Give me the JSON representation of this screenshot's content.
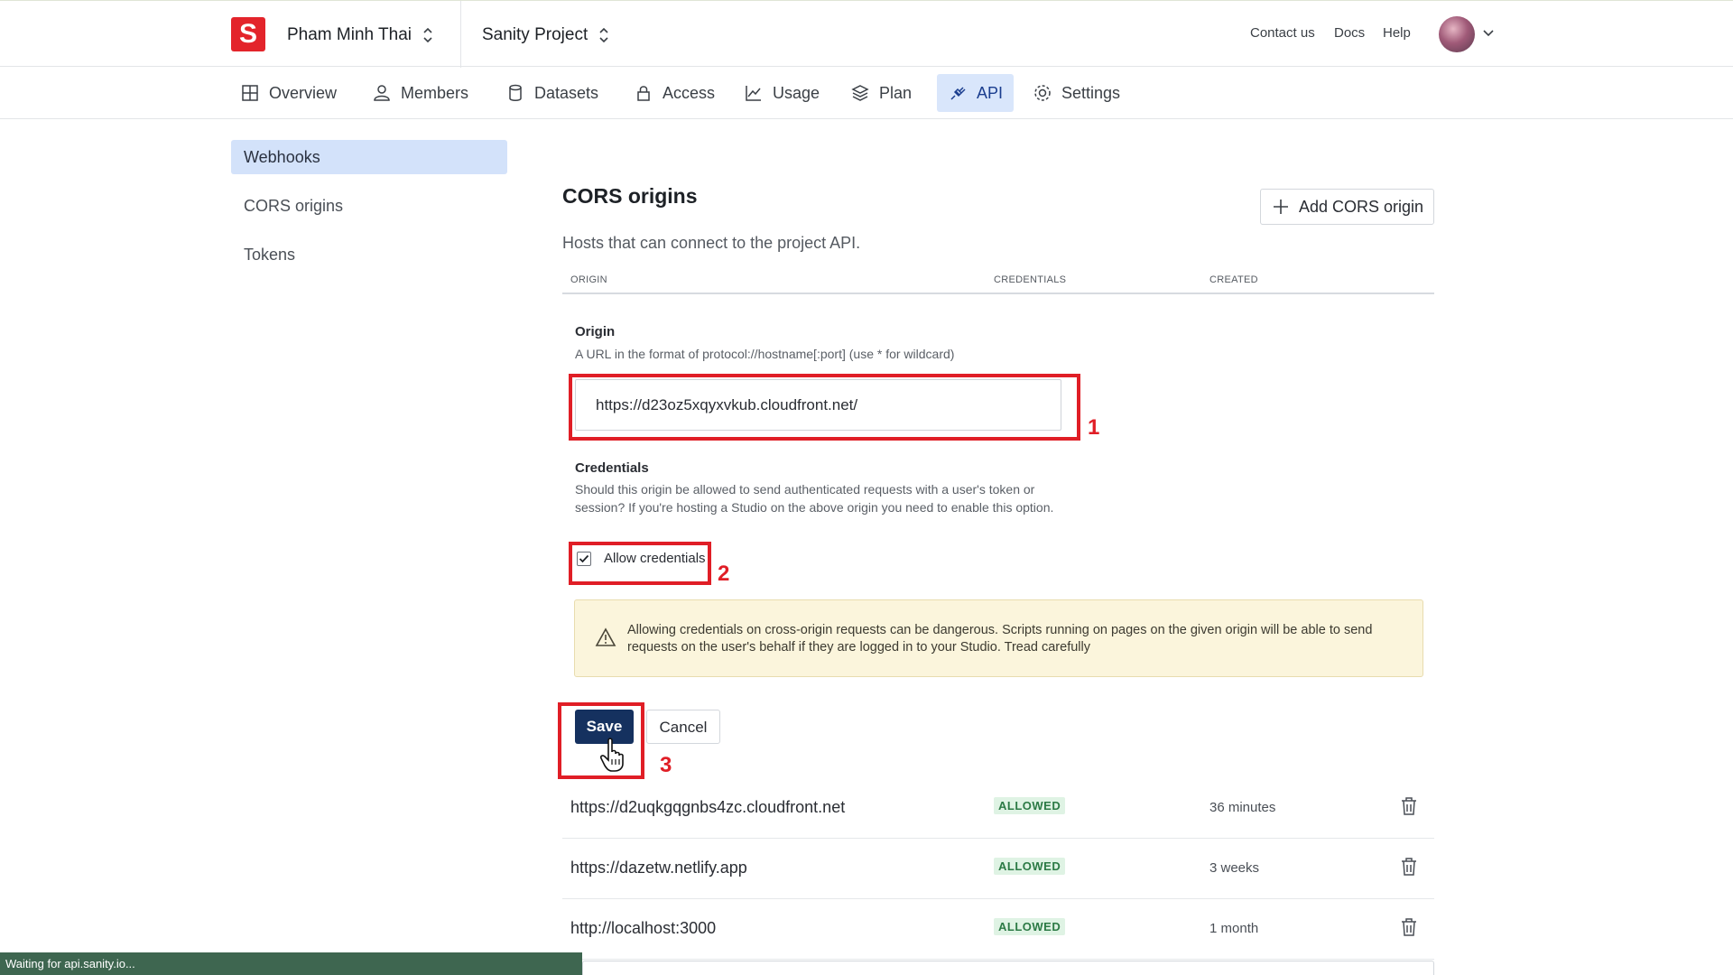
{
  "app": {
    "logo_letter": "S",
    "org_name": "Pham Minh Thai",
    "project_name": "Sanity Project",
    "brand_color": "#e3242b"
  },
  "toplinks": {
    "contact": "Contact us",
    "docs": "Docs",
    "help": "Help"
  },
  "tabs": [
    {
      "label": "Overview",
      "icon": "grid-icon"
    },
    {
      "label": "Members",
      "icon": "users-icon"
    },
    {
      "label": "Datasets",
      "icon": "database-icon"
    },
    {
      "label": "Access",
      "icon": "lock-icon"
    },
    {
      "label": "Usage",
      "icon": "chart-icon"
    },
    {
      "label": "Plan",
      "icon": "layers-icon"
    },
    {
      "label": "API",
      "icon": "plug-icon",
      "active": true
    },
    {
      "label": "Settings",
      "icon": "gear-icon"
    }
  ],
  "sidenav": [
    {
      "label": "Webhooks",
      "active": true
    },
    {
      "label": "CORS origins"
    },
    {
      "label": "Tokens"
    }
  ],
  "cors": {
    "title": "CORS origins",
    "description": "Hosts that can connect to the project API.",
    "add_button": "Add CORS origin",
    "columns": [
      "ORIGIN",
      "CREDENTIALS",
      "CREATED"
    ]
  },
  "form": {
    "origin_label": "Origin",
    "origin_help": "A URL in the format of protocol://hostname[:port] (use * for wildcard)",
    "origin_value": "https://d23oz5xqyxvkub.cloudfront.net/",
    "credentials_label": "Credentials",
    "credentials_help": "Should this origin be allowed to send authenticated requests with a user's token or session? If you're hosting a Studio on the above origin you need to enable this option.",
    "allow_credentials_label": "Allow credentials",
    "allow_credentials_checked": true,
    "warning_text": "Allowing credentials on cross-origin requests can be dangerous. Scripts running on pages on the given origin will be able to send requests on the user's behalf if they are logged in to your Studio. Tread carefully",
    "save_label": "Save",
    "cancel_label": "Cancel"
  },
  "annotations": [
    "1",
    "2",
    "3"
  ],
  "origins": [
    {
      "origin": "https://d2uqkgqgnbs4zc.cloudfront.net",
      "credentials": "ALLOWED",
      "created": "36 minutes"
    },
    {
      "origin": "https://dazetw.netlify.app",
      "credentials": "ALLOWED",
      "created": "3 weeks"
    },
    {
      "origin": "http://localhost:3000",
      "credentials": "ALLOWED",
      "created": "1 month"
    }
  ],
  "status_bar": "Waiting for api.sanity.io..."
}
